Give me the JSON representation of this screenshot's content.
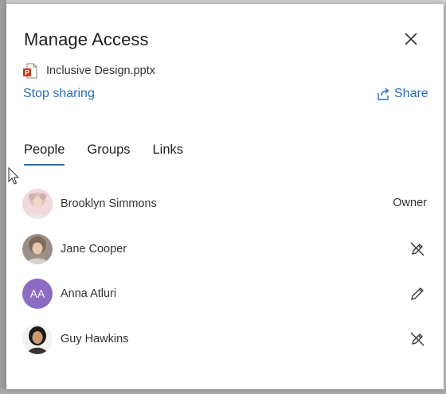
{
  "dialog": {
    "title": "Manage Access",
    "close_icon": "close-icon"
  },
  "file": {
    "icon": "powerpoint-file-icon",
    "name": "Inclusive Design.pptx"
  },
  "actions": {
    "stop_sharing": "Stop sharing",
    "share": "Share",
    "share_icon": "share-icon"
  },
  "tabs": [
    {
      "label": "People",
      "active": true
    },
    {
      "label": "Groups",
      "active": false
    },
    {
      "label": "Links",
      "active": false
    }
  ],
  "people": [
    {
      "name": "Brooklyn Simmons",
      "role": "Owner",
      "avatar": "photo"
    },
    {
      "name": "Jane Cooper",
      "permission_icon": "cannot-edit-icon",
      "avatar": "photo"
    },
    {
      "name": "Anna Atluri",
      "initials": "AA",
      "permission_icon": "can-edit-icon",
      "avatar_color": "#8c6bc2"
    },
    {
      "name": "Guy Hawkins",
      "permission_icon": "cannot-edit-icon",
      "avatar": "photo"
    }
  ],
  "colors": {
    "accent": "#2b6cb5",
    "text": "#201f1e"
  }
}
